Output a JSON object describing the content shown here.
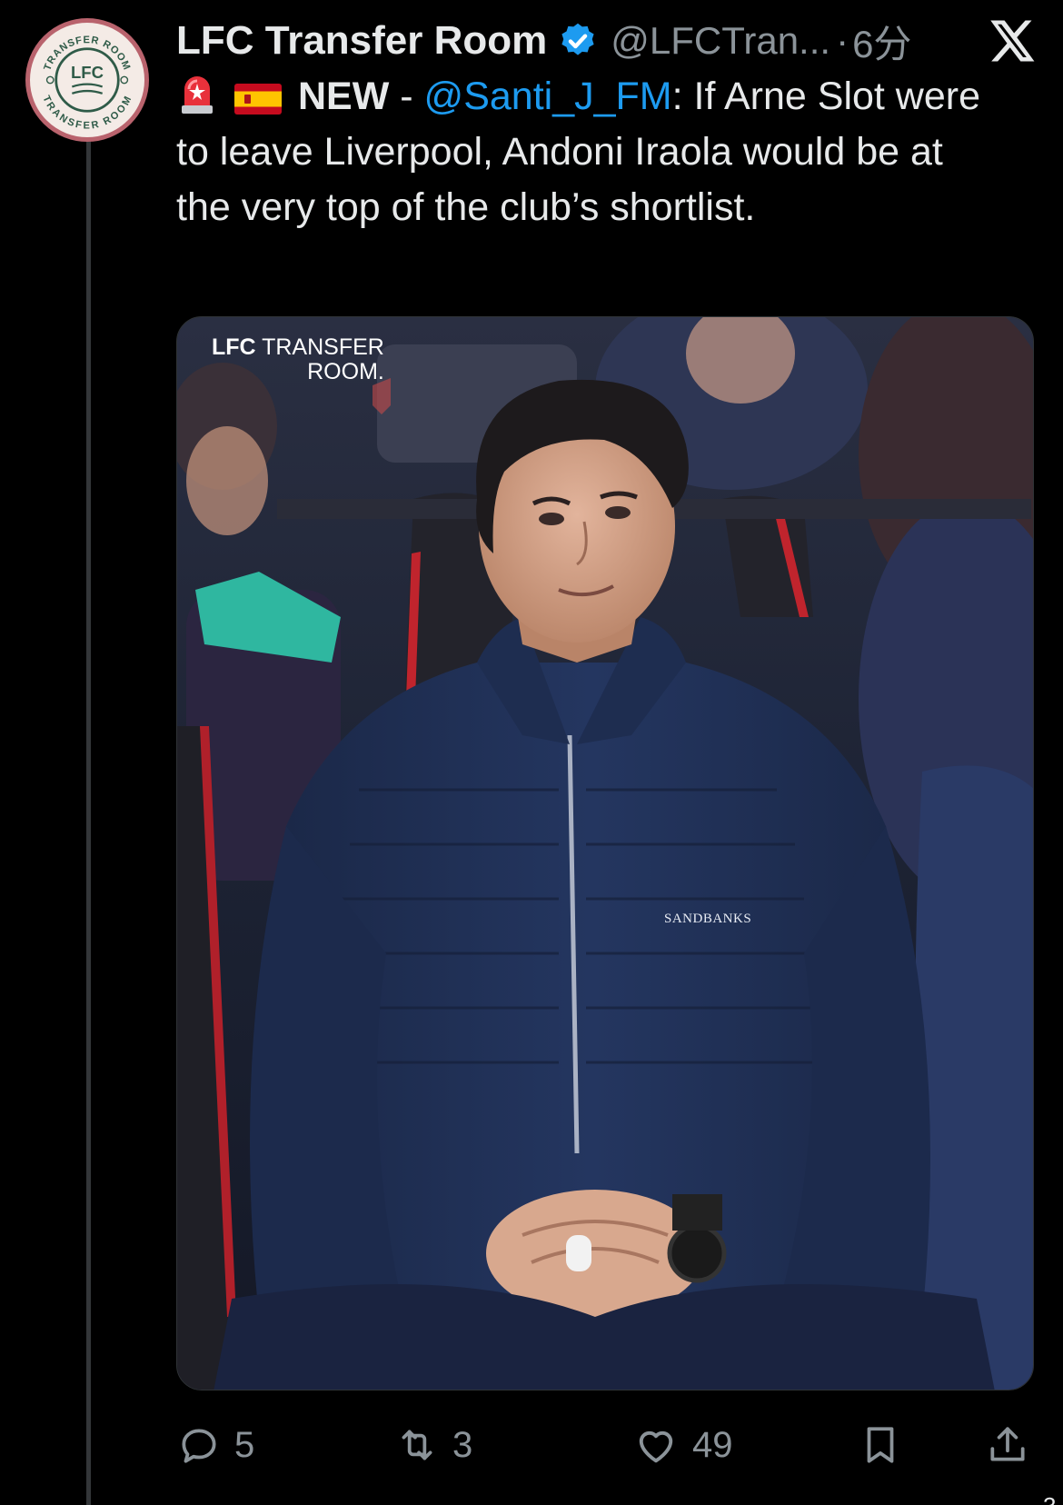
{
  "tweet": {
    "author_name": "LFC Transfer Room",
    "handle": "@LFCTran...",
    "separator": "·",
    "time": "6分",
    "platform_logo": "x-logo-icon",
    "verified_icon": "verified-badge-icon",
    "text": {
      "emoji_1": "siren-emoji",
      "emoji_2": "spain-flag-emoji",
      "new_label": "NEW",
      "dash": " - ",
      "mention": "@Santi_J_FM",
      "body": ": If Arne Slot were to leave Liverpool, Andoni Iraola would be at the very top of the club’s shortlist."
    },
    "avatar": {
      "ring_top": "TRANSFER ROOM",
      "ring_bottom": "TRANSFER ROOM",
      "center": "LFC",
      "colors": {
        "ring": "#b9636d",
        "inner": "#2f5b48",
        "bg": "#f4ebe6"
      }
    }
  },
  "media": {
    "watermark_line1_bold": "LFC",
    "watermark_line1_rest": " TRANSFER",
    "watermark_line2": "ROOM.",
    "jacket_brand": "SANDBANKS"
  },
  "actions": {
    "reply": {
      "icon": "reply-icon",
      "count": "5"
    },
    "retweet": {
      "icon": "retweet-icon",
      "count": "3"
    },
    "like": {
      "icon": "heart-icon",
      "count": "49"
    },
    "bookmark": {
      "icon": "bookmark-icon"
    },
    "share": {
      "icon": "share-icon"
    }
  },
  "corner_mark": "3",
  "colors": {
    "background": "#000000",
    "text": "#e7e9ea",
    "muted": "#8b9399",
    "link": "#1d9bf0",
    "verified": "#1d9bf0"
  }
}
